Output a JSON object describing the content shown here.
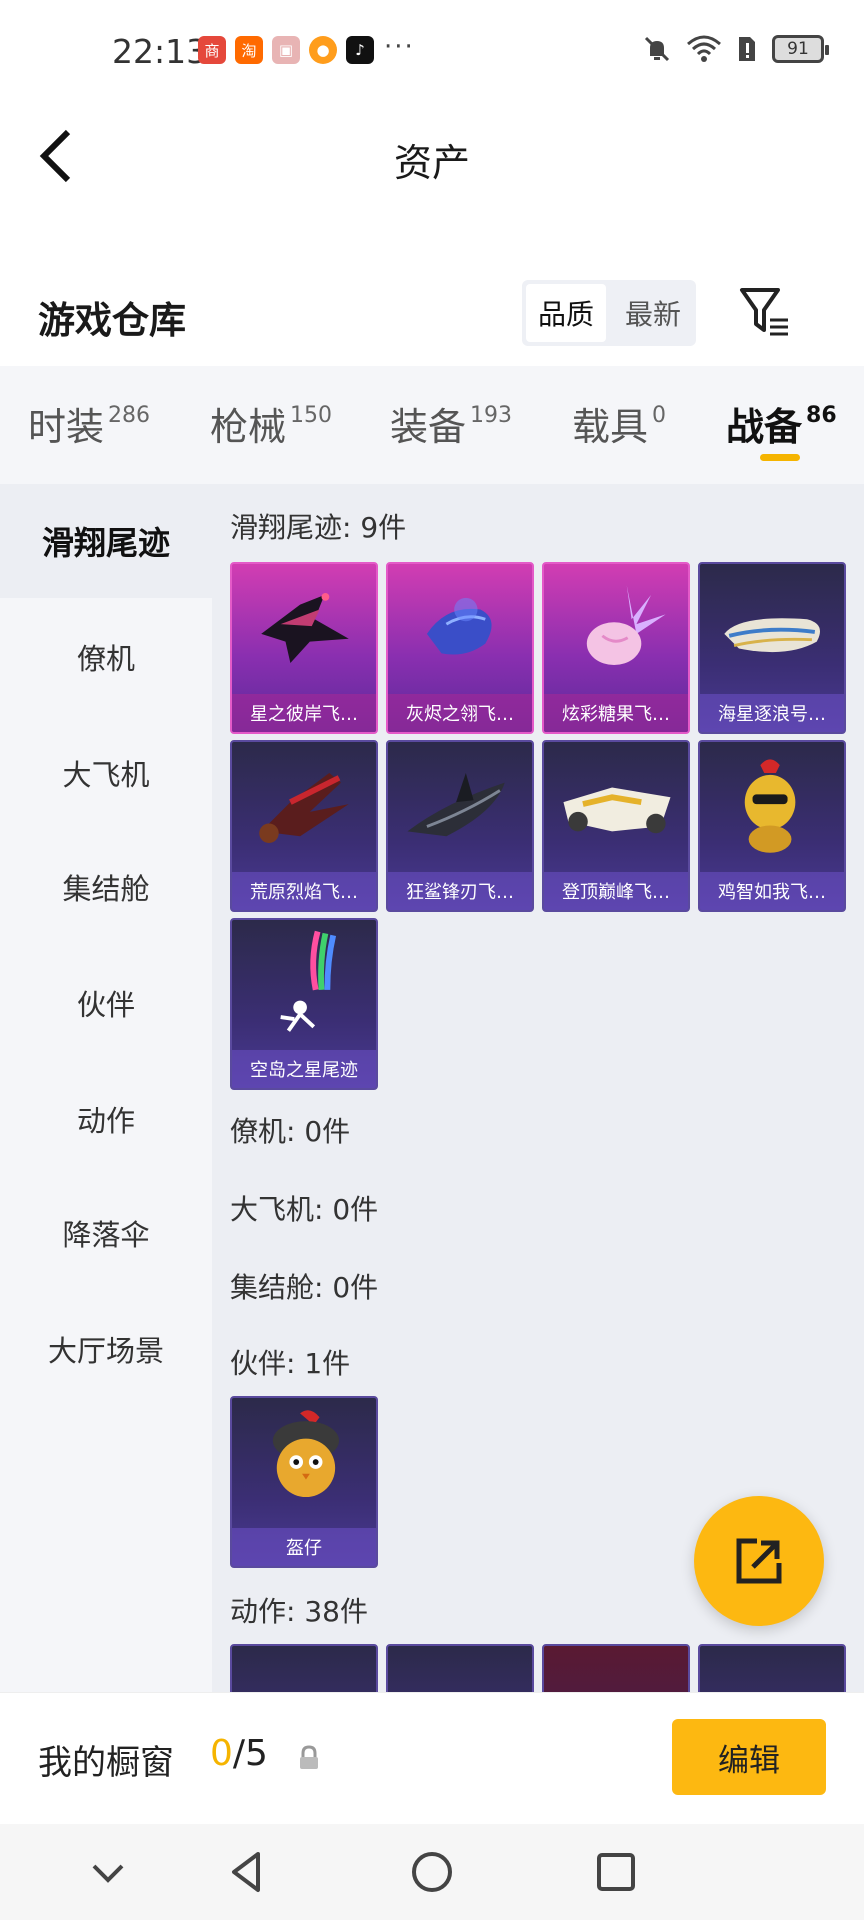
{
  "status_bar": {
    "time": "22:13",
    "app_icons": [
      {
        "name": "huawei-mall-icon",
        "glyph": "商",
        "color": "#e5483b"
      },
      {
        "name": "taobao-icon",
        "glyph": "淘",
        "color": "#ff6a00"
      },
      {
        "name": "gift-icon",
        "glyph": "▣",
        "color": "#e8b4b4"
      },
      {
        "name": "orange-icon",
        "glyph": "●",
        "color": "#ff9d1c"
      },
      {
        "name": "tiktok-icon",
        "glyph": "♪",
        "color": "#111111"
      }
    ],
    "more": "···",
    "battery": "91"
  },
  "header": {
    "title": "资产"
  },
  "warehouse": {
    "title": "游戏仓库",
    "sort_options": [
      "品质",
      "最新"
    ]
  },
  "category_tabs": [
    {
      "label": "时装",
      "count": "286"
    },
    {
      "label": "枪械",
      "count": "150"
    },
    {
      "label": "装备",
      "count": "193"
    },
    {
      "label": "载具",
      "count": "0"
    },
    {
      "label": "战备",
      "count": "86"
    }
  ],
  "sidebar": {
    "items": [
      "滑翔尾迹",
      "僚机",
      "大飞机",
      "集结舱",
      "伙伴",
      "动作",
      "降落伞",
      "大厅场景"
    ]
  },
  "sections": [
    {
      "heading": "滑翔尾迹: 9件"
    },
    {
      "heading": "僚机: 0件"
    },
    {
      "heading": "大飞机: 0件"
    },
    {
      "heading": "集结舱: 0件"
    },
    {
      "heading": "伙伴: 1件"
    },
    {
      "heading": "动作: 38件"
    }
  ],
  "glide_items": [
    {
      "label": "星之彼岸飞…",
      "rarity": "pink"
    },
    {
      "label": "灰烬之翎飞…",
      "rarity": "pink"
    },
    {
      "label": "炫彩糖果飞…",
      "rarity": "pink"
    },
    {
      "label": "海星逐浪号…",
      "rarity": "dark"
    },
    {
      "label": "荒原烈焰飞…",
      "rarity": "dark"
    },
    {
      "label": "狂鲨锋刃飞…",
      "rarity": "dark"
    },
    {
      "label": "登顶巅峰飞…",
      "rarity": "dark"
    },
    {
      "label": "鸡智如我飞…",
      "rarity": "dark"
    },
    {
      "label": "空岛之星尾迹",
      "rarity": "dark"
    }
  ],
  "companion_items": [
    {
      "label": "盔仔",
      "rarity": "dark"
    }
  ],
  "showcase": {
    "title": "我的橱窗",
    "count_used": "0",
    "count_total": "/5",
    "edit_label": "编辑"
  }
}
